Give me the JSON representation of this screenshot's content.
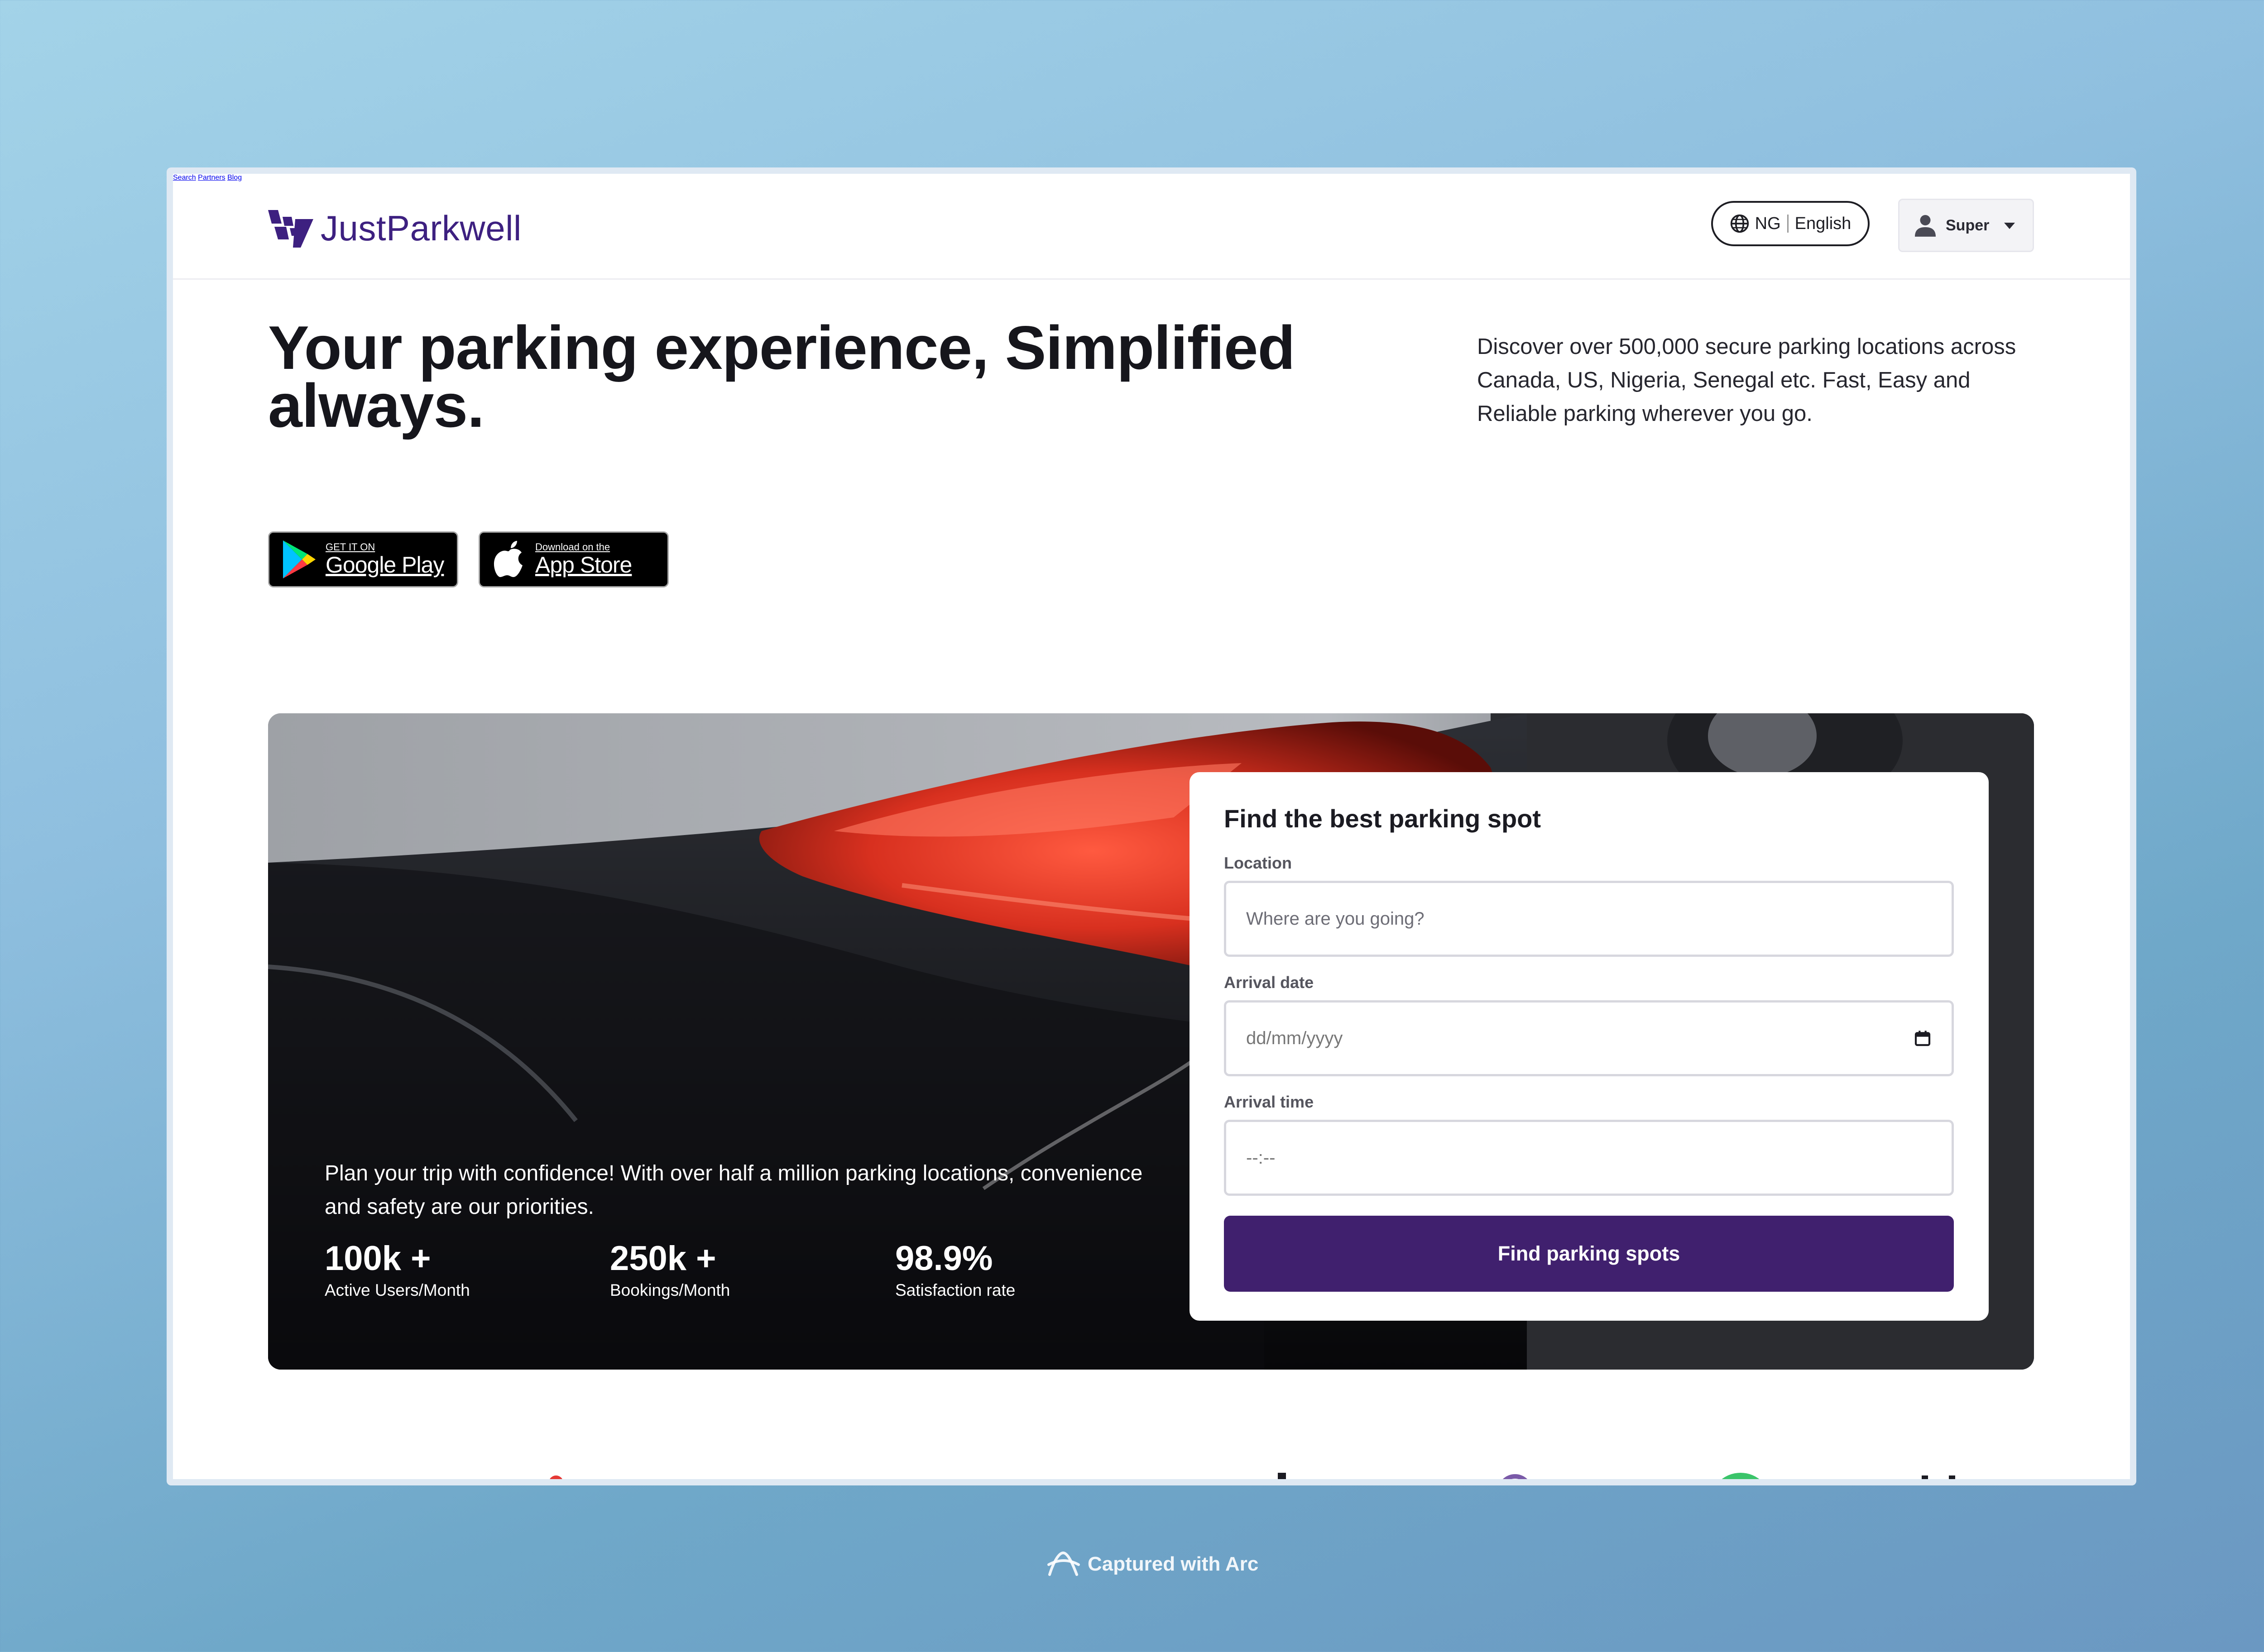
{
  "brand": {
    "name": "JustParkwell",
    "color": "#3d2080"
  },
  "nav": {
    "items": [
      "Search",
      "Partners",
      "Blog"
    ]
  },
  "locale": {
    "country": "NG",
    "language": "English"
  },
  "user": {
    "name": "Super"
  },
  "hero": {
    "title": "Your parking experience, Simplified always.",
    "description": "Discover over 500,000 secure parking locations across Canada, US, Nigeria, Senegal etc. Fast, Easy and Reliable parking wherever you go."
  },
  "stores": {
    "google": {
      "small": "GET IT ON",
      "big": "Google Play"
    },
    "apple": {
      "small": "Download on the",
      "big": "App Store"
    }
  },
  "banner": {
    "text": "Plan your trip with confidence! With over half a million parking locations, convenience and safety are our priorities.",
    "stats": [
      {
        "value": "100k +",
        "label": "Active Users/Month"
      },
      {
        "value": "250k +",
        "label": "Bookings/Month"
      },
      {
        "value": "98.9%",
        "label": "Satisfaction rate"
      }
    ]
  },
  "search_form": {
    "title": "Find the best parking spot",
    "location_label": "Location",
    "location_placeholder": "Where are you going?",
    "date_label": "Arrival date",
    "date_placeholder": "dd/mm/yyyy",
    "time_label": "Arrival time",
    "time_placeholder": "--:--",
    "submit_label": "Find parking spots",
    "accent": "#40206e"
  },
  "footer": {
    "captured": "Captured with Arc"
  }
}
